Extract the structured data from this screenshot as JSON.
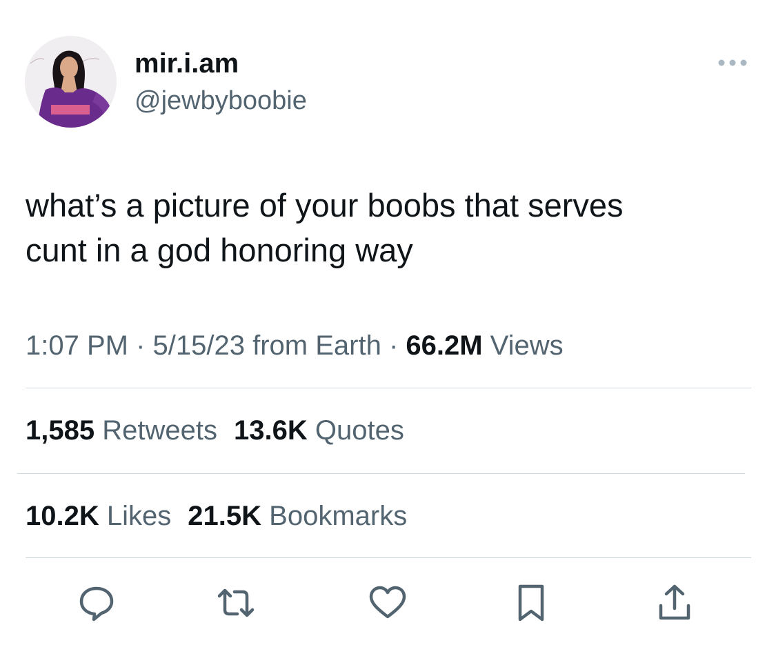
{
  "user": {
    "display_name": "mir.i.am",
    "handle": "@jewbyboobie",
    "avatar_icon": "profile-photo"
  },
  "tweet": {
    "text_lines": [
      "what’s a picture of your boobs that serves",
      "cunt in a god honoring way"
    ],
    "time": "1:07 PM",
    "date": "5/15/23",
    "source": "from Earth",
    "views_count": "66.2M",
    "views_label": "Views"
  },
  "stats": {
    "retweets_count": "1,585",
    "retweets_label": "Retweets",
    "quotes_count": "13.6K",
    "quotes_label": "Quotes",
    "likes_count": "10.2K",
    "likes_label": "Likes",
    "bookmarks_count": "21.5K",
    "bookmarks_label": "Bookmarks"
  },
  "actions": [
    "reply-icon",
    "retweet-icon",
    "like-icon",
    "bookmark-icon",
    "share-icon"
  ],
  "colors": {
    "text_primary": "#0f1419",
    "text_secondary": "#536471",
    "divider": "#cfd9de",
    "icon": "#536471"
  }
}
